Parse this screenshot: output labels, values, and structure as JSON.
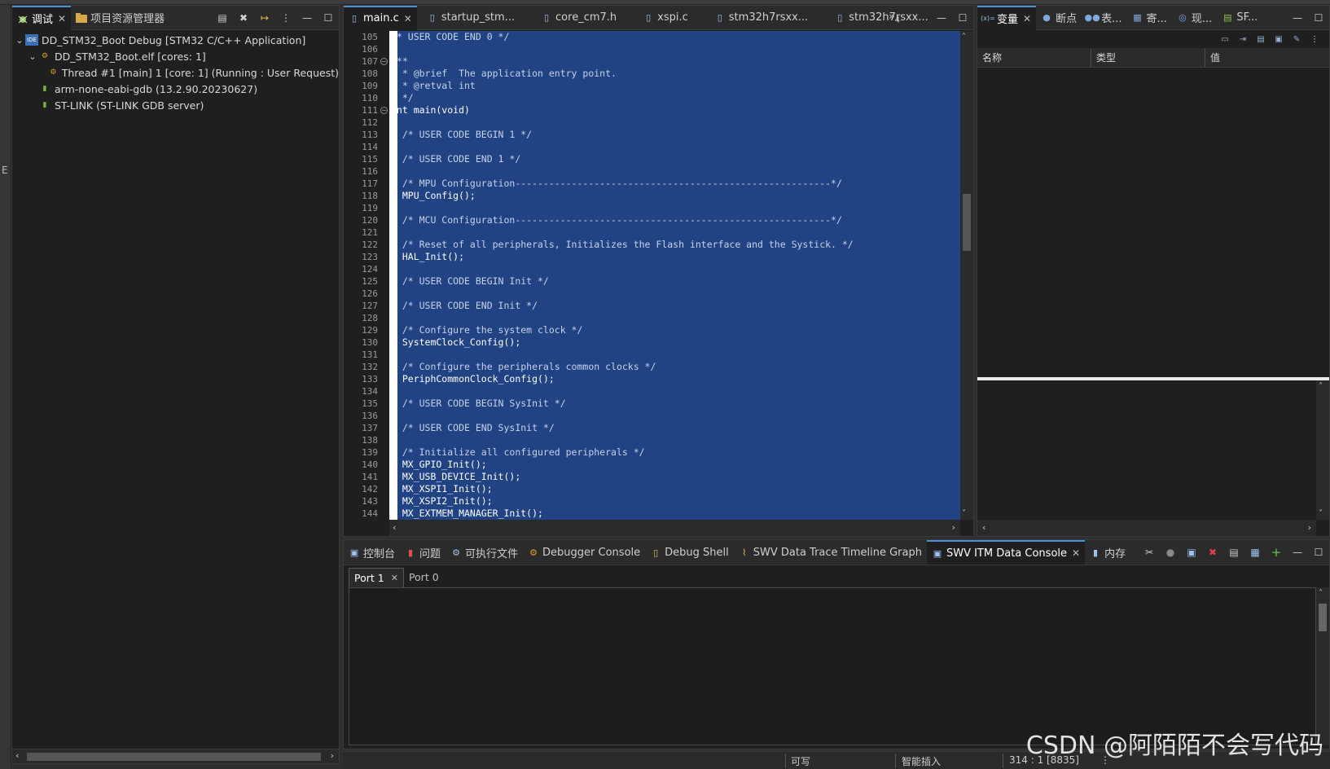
{
  "debug_view": {
    "tabs": [
      {
        "label": "调试",
        "icon": "debug-bug-icon"
      },
      {
        "label": "项目资源管理器",
        "icon": "project-folder-icon"
      }
    ],
    "tree": [
      {
        "label": "DD_STM32_Boot Debug [STM32 C/C++ Application]",
        "icon": "ide-launch-icon",
        "level": 0,
        "expanded": true
      },
      {
        "label": "DD_STM32_Boot.elf [cores: 1]",
        "icon": "process-icon",
        "level": 1,
        "expanded": true
      },
      {
        "label": "Thread #1 [main] 1 [core: 1] (Running : User Request)",
        "icon": "thread-running-icon",
        "level": 2
      },
      {
        "label": "arm-none-eabi-gdb (13.2.90.20230627)",
        "icon": "gdb-process-icon",
        "level": 1
      },
      {
        "label": "ST-LINK (ST-LINK GDB server)",
        "icon": "gdb-server-icon",
        "level": 1
      }
    ]
  },
  "editor": {
    "tabs": [
      {
        "label": "main.c",
        "icon": "c-file-icon",
        "active": true
      },
      {
        "label": "startup_stm...",
        "icon": "asm-file-icon"
      },
      {
        "label": "core_cm7.h",
        "icon": "h-file-icon"
      },
      {
        "label": "xspi.c",
        "icon": "c-file-icon"
      },
      {
        "label": "stm32h7rsxx...",
        "icon": "c-file-icon"
      },
      {
        "label": "stm32h7rsxx...",
        "icon": "c-file-icon"
      }
    ],
    "overflow_label": "»",
    "overflow_count": "4",
    "lines": [
      {
        "n": "105",
        "text": "/* USER CODE END 0 */"
      },
      {
        "n": "106",
        "text": ""
      },
      {
        "n": "107",
        "text": "/**"
      },
      {
        "n": "108",
        "text": "  * @brief  The application entry point."
      },
      {
        "n": "109",
        "text": "  * @retval int"
      },
      {
        "n": "110",
        "text": "  */"
      },
      {
        "n": "111",
        "text": "int main(void)"
      },
      {
        "n": "112",
        "text": "{"
      },
      {
        "n": "113",
        "text": "  /* USER CODE BEGIN 1 */"
      },
      {
        "n": "114",
        "text": ""
      },
      {
        "n": "115",
        "text": "  /* USER CODE END 1 */"
      },
      {
        "n": "116",
        "text": ""
      },
      {
        "n": "117",
        "text": "  /* MPU Configuration--------------------------------------------------------*/"
      },
      {
        "n": "118",
        "text": "  MPU_Config();"
      },
      {
        "n": "119",
        "text": ""
      },
      {
        "n": "120",
        "text": "  /* MCU Configuration--------------------------------------------------------*/"
      },
      {
        "n": "121",
        "text": ""
      },
      {
        "n": "122",
        "text": "  /* Reset of all peripherals, Initializes the Flash interface and the Systick. */"
      },
      {
        "n": "123",
        "text": "  HAL_Init();"
      },
      {
        "n": "124",
        "text": ""
      },
      {
        "n": "125",
        "text": "  /* USER CODE BEGIN Init */"
      },
      {
        "n": "126",
        "text": ""
      },
      {
        "n": "127",
        "text": "  /* USER CODE END Init */"
      },
      {
        "n": "128",
        "text": ""
      },
      {
        "n": "129",
        "text": "  /* Configure the system clock */"
      },
      {
        "n": "130",
        "text": "  SystemClock_Config();"
      },
      {
        "n": "131",
        "text": ""
      },
      {
        "n": "132",
        "text": "  /* Configure the peripherals common clocks */"
      },
      {
        "n": "133",
        "text": "  PeriphCommonClock_Config();"
      },
      {
        "n": "134",
        "text": ""
      },
      {
        "n": "135",
        "text": "  /* USER CODE BEGIN SysInit */"
      },
      {
        "n": "136",
        "text": ""
      },
      {
        "n": "137",
        "text": "  /* USER CODE END SysInit */"
      },
      {
        "n": "138",
        "text": ""
      },
      {
        "n": "139",
        "text": "  /* Initialize all configured peripherals */"
      },
      {
        "n": "140",
        "text": "  MX_GPIO_Init();"
      },
      {
        "n": "141",
        "text": "  MX_USB_DEVICE_Init();"
      },
      {
        "n": "142",
        "text": "  MX_XSPI1_Init();"
      },
      {
        "n": "143",
        "text": "  MX_XSPI2_Init();"
      },
      {
        "n": "144",
        "text": "  MX_EXTMEM_MANAGER_Init();"
      }
    ]
  },
  "variables_view": {
    "tabs": [
      {
        "label": "变量",
        "icon": "variables-icon",
        "active": true
      },
      {
        "label": "断点",
        "icon": "breakpoints-icon"
      },
      {
        "label": "表...",
        "icon": "expressions-icon"
      },
      {
        "label": "寄...",
        "icon": "registers-icon"
      },
      {
        "label": "现...",
        "icon": "live-expressions-icon"
      },
      {
        "label": "SF...",
        "icon": "sfr-icon"
      }
    ],
    "columns": [
      "名称",
      "类型",
      "值"
    ]
  },
  "console_view": {
    "tabs": [
      {
        "label": "控制台",
        "icon": "console-icon"
      },
      {
        "label": "问题",
        "icon": "problems-icon"
      },
      {
        "label": "可执行文件",
        "icon": "executables-icon"
      },
      {
        "label": "Debugger Console",
        "icon": "debugger-console-icon"
      },
      {
        "label": "Debug Shell",
        "icon": "debug-shell-icon"
      },
      {
        "label": "SWV Data Trace Timeline Graph",
        "icon": "timeline-graph-icon"
      },
      {
        "label": "SWV ITM Data Console",
        "icon": "itm-console-icon",
        "active": true
      },
      {
        "label": "内存",
        "icon": "memory-icon"
      }
    ],
    "ports": [
      {
        "label": "Port 1",
        "active": true
      },
      {
        "label": "Port 0"
      }
    ],
    "itm_lines": [
      "",
      "",
      "",
      "",
      "",
      "",
      "",
      "",
      "",
      "",
      "",
      "",
      "",
      ""
    ]
  },
  "status_bar": {
    "writable": "可写",
    "insert_mode": "智能插入",
    "position": "314 : 1 [8835]",
    "status_hint": "⋮"
  },
  "watermark": "CSDN @阿陌陌不会写代码",
  "colors": {
    "selection": "#214283",
    "accent": "#4a8fd8",
    "background": "#1f1f1f"
  }
}
